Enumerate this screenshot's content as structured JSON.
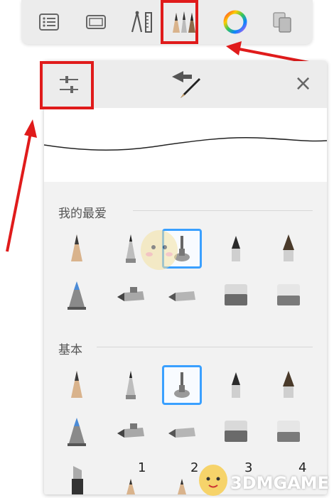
{
  "toolbar": {
    "buttons": [
      {
        "name": "layers-list-icon"
      },
      {
        "name": "canvas-frame-icon"
      },
      {
        "name": "ruler-compass-icon"
      },
      {
        "name": "brushes-icon"
      },
      {
        "name": "color-wheel-icon"
      },
      {
        "name": "copy-layers-icon"
      }
    ],
    "highlight_color": "#e01b1b"
  },
  "panel": {
    "close_label": "×",
    "sections": [
      {
        "title": "我的最爱"
      },
      {
        "title": "基本"
      }
    ],
    "selected_color": "#3aa0ff",
    "numbers": [
      "1",
      "2",
      "3",
      "4"
    ]
  },
  "watermark": {
    "text": "3DMGAME"
  }
}
